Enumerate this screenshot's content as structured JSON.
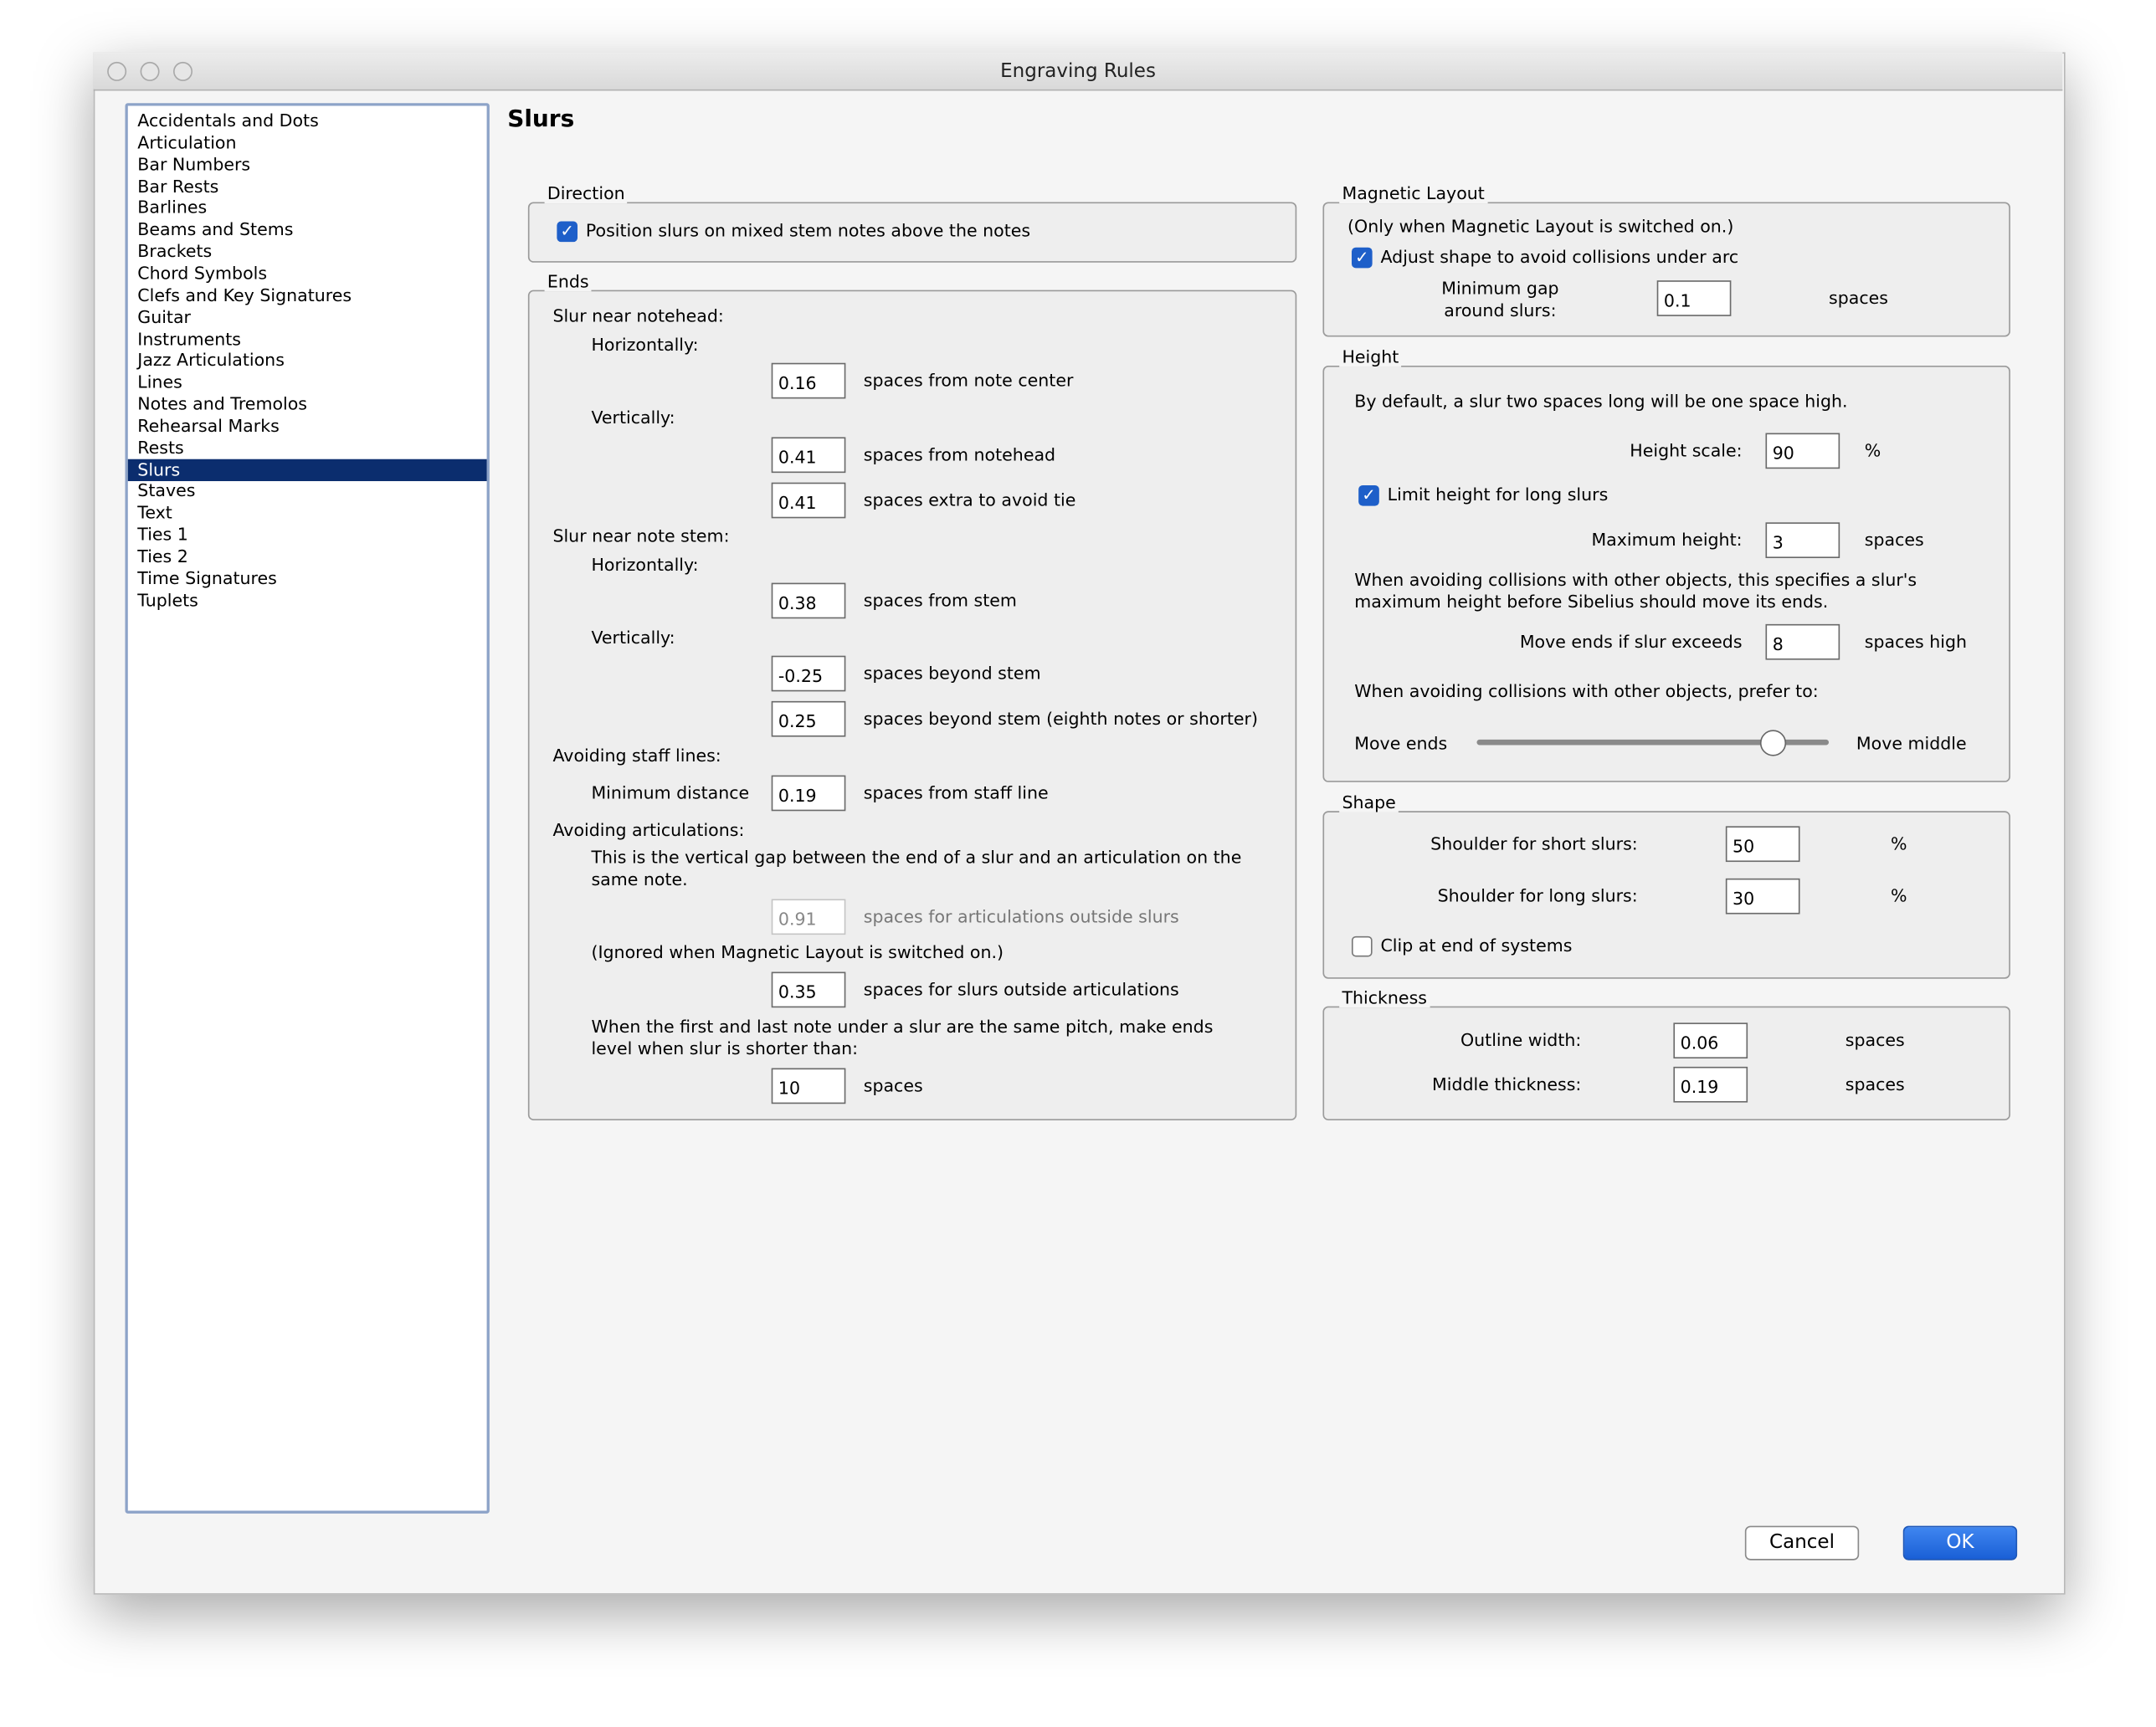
{
  "window": {
    "title": "Engraving Rules"
  },
  "sidebar": {
    "items": [
      "Accidentals and Dots",
      "Articulation",
      "Bar Numbers",
      "Bar Rests",
      "Barlines",
      "Beams and Stems",
      "Brackets",
      "Chord Symbols",
      "Clefs and Key Signatures",
      "Guitar",
      "Instruments",
      "Jazz Articulations",
      "Lines",
      "Notes and Tremolos",
      "Rehearsal Marks",
      "Rests",
      "Slurs",
      "Staves",
      "Text",
      "Ties 1",
      "Ties 2",
      "Time Signatures",
      "Tuplets"
    ],
    "selected": "Slurs"
  },
  "page": {
    "title": "Slurs"
  },
  "direction": {
    "legend": "Direction",
    "checkbox_label": "Position slurs on mixed stem notes above the notes",
    "checked": true
  },
  "ends": {
    "legend": "Ends",
    "notehead_heading": "Slur near notehead:",
    "horizontally": "Horizontally:",
    "vertically": "Vertically:",
    "nh_horiz_value": "0.16",
    "nh_horiz_label": "spaces from note center",
    "nh_vert_value": "0.41",
    "nh_vert_label": "spaces from notehead",
    "nh_tie_value": "0.41",
    "nh_tie_label": "spaces extra to avoid tie",
    "stem_heading": "Slur near note stem:",
    "st_horiz_value": "0.38",
    "st_horiz_label": "spaces from stem",
    "st_vert_value": "-0.25",
    "st_vert_label": "spaces beyond stem",
    "st_eighth_value": "0.25",
    "st_eighth_label": "spaces beyond stem (eighth notes or shorter)",
    "staff_heading": "Avoiding staff lines:",
    "min_distance_label": "Minimum distance",
    "min_distance_value": "0.19",
    "min_distance_unit": "spaces from staff line",
    "artic_heading": "Avoiding articulations:",
    "artic_desc": "This is the vertical gap between the end of a slur and an articulation on the same note.",
    "artic_outside_value": "0.91",
    "artic_outside_label": "spaces for articulations outside slurs",
    "ignored_note": "(Ignored when Magnetic Layout is switched on.)",
    "slurs_outside_value": "0.35",
    "slurs_outside_label": "spaces for slurs outside articulations",
    "level_desc": "When the first and last note under a slur are the same pitch, make ends level when slur is shorter than:",
    "level_value": "10",
    "level_unit": "spaces"
  },
  "magnetic": {
    "legend": "Magnetic Layout",
    "note": "(Only when Magnetic Layout is switched on.)",
    "checkbox_label": "Adjust shape to avoid collisions under arc",
    "checked": true,
    "gap_label": "Minimum gap around slurs:",
    "gap_value": "0.1",
    "gap_unit": "spaces"
  },
  "height": {
    "legend": "Height",
    "desc": "By default, a slur two spaces long will be one space high.",
    "scale_label": "Height scale:",
    "scale_value": "90",
    "scale_unit": "%",
    "limit_label": "Limit height for long slurs",
    "limit_checked": true,
    "max_label": "Maximum height:",
    "max_value": "3",
    "max_unit": "spaces",
    "collision_desc": "When avoiding collisions with other objects, this specifies a slur's maximum height before Sibelius should move its ends.",
    "exceeds_label": "Move ends if slur exceeds",
    "exceeds_value": "8",
    "exceeds_unit": "spaces high",
    "prefer_label": "When avoiding collisions with other objects, prefer to:",
    "slider_left": "Move ends",
    "slider_right": "Move middle",
    "slider_fraction": 0.84
  },
  "shape": {
    "legend": "Shape",
    "short_label": "Shoulder for short slurs:",
    "short_value": "50",
    "long_label": "Shoulder for long slurs:",
    "long_value": "30",
    "unit": "%",
    "clip_label": "Clip at end of systems",
    "clip_checked": false
  },
  "thickness": {
    "legend": "Thickness",
    "outline_label": "Outline width:",
    "outline_value": "0.06",
    "middle_label": "Middle thickness:",
    "middle_value": "0.19",
    "unit": "spaces"
  },
  "buttons": {
    "cancel": "Cancel",
    "ok": "OK"
  },
  "colors": {
    "selection": "#0b2d6e",
    "accent": "#1e5fc9"
  }
}
